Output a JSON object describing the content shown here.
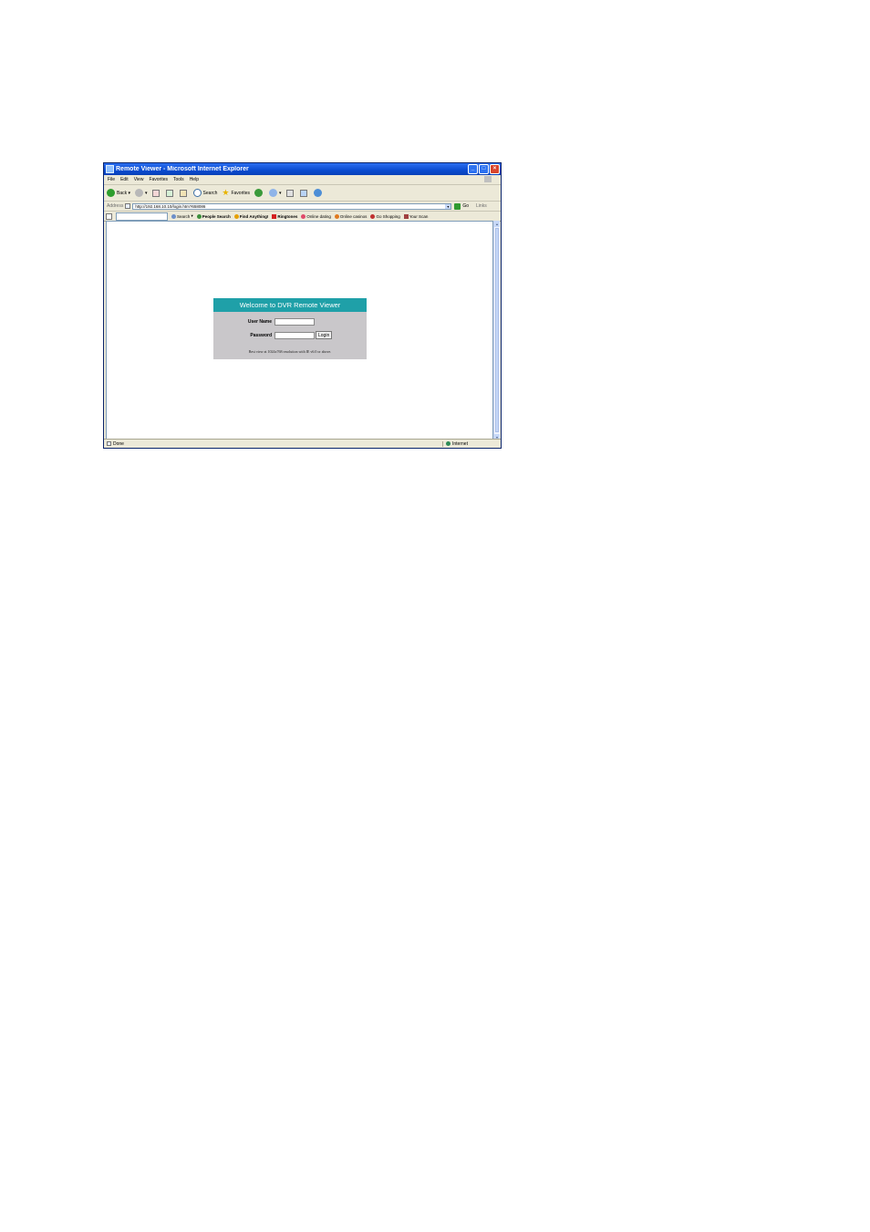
{
  "window": {
    "title": "Remote Viewer - Microsoft Internet Explorer"
  },
  "menu": [
    "File",
    "Edit",
    "View",
    "Favorites",
    "Tools",
    "Help"
  ],
  "toolbar": {
    "back": "Back",
    "search": "Search",
    "favorites": "Favorites"
  },
  "address": {
    "label": "Address",
    "url": "http://192.168.10.10/login.htm?658086",
    "go": "Go",
    "links": "Links"
  },
  "searchbar": {
    "search_btn": "Search",
    "items": [
      {
        "label": "People Search",
        "bold": true
      },
      {
        "label": "Find Anything!",
        "bold": true
      },
      {
        "label": "Ringtones",
        "bold": true
      },
      {
        "label": "Online dating",
        "bold": false
      },
      {
        "label": "Online casinos",
        "bold": false
      },
      {
        "label": "Go Shopping",
        "bold": false
      },
      {
        "label": "Your Scan",
        "bold": false
      }
    ]
  },
  "login": {
    "header": "Welcome to DVR Remote Viewer",
    "username_label": "User Name",
    "password_label": "Password",
    "login_button": "Login",
    "note": "Best view at 1024x768 resolution with IE v6.0 or above."
  },
  "status": {
    "left": "Done",
    "zone": "Internet"
  }
}
